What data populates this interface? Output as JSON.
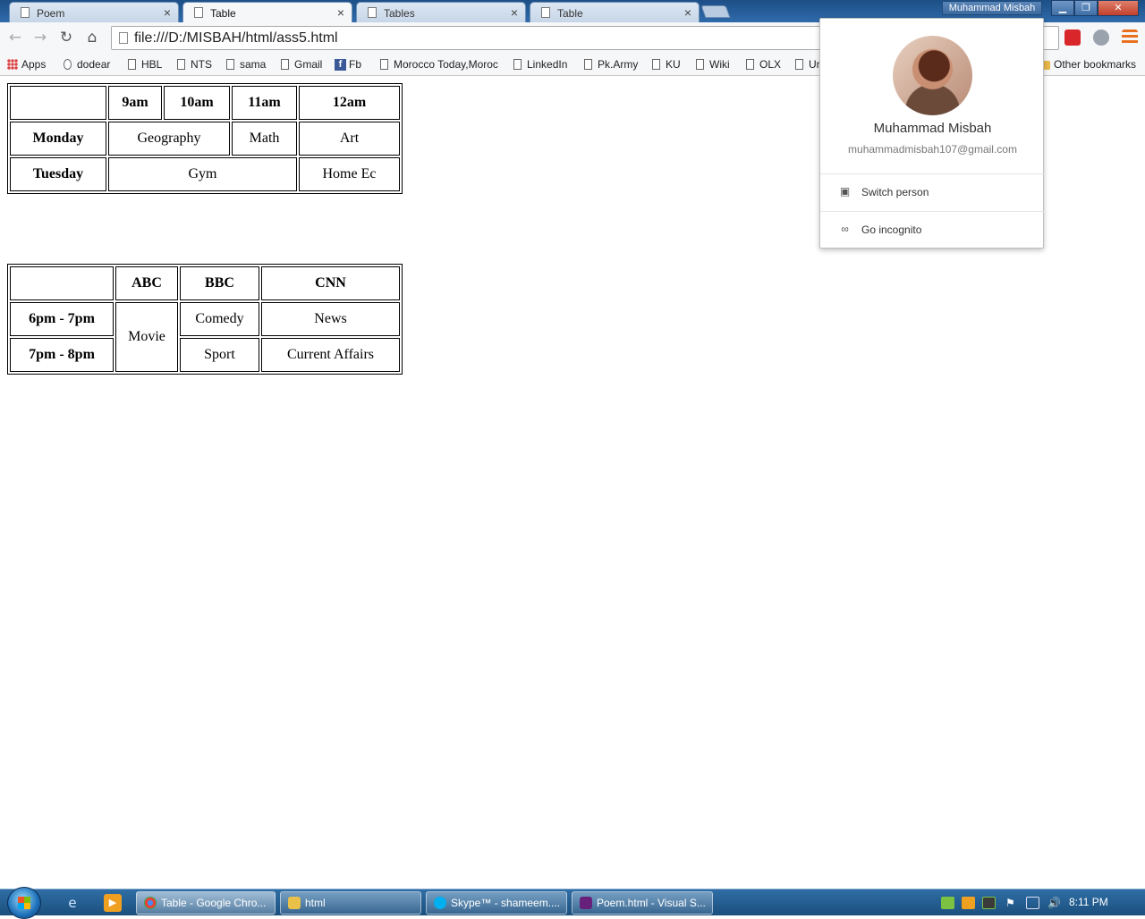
{
  "browser": {
    "tabs": [
      {
        "title": "Poem",
        "active": false
      },
      {
        "title": "Table",
        "active": true
      },
      {
        "title": "Tables",
        "active": false
      },
      {
        "title": "Table",
        "active": false
      }
    ],
    "profile_chip": "Muhammad Misbah",
    "url": "file:///D:/MISBAH/html/ass5.html",
    "bookmarks": [
      {
        "label": "Apps",
        "icon": "apps-grid-icon"
      },
      {
        "label": "dodear",
        "icon": "globe-icon"
      },
      {
        "label": "HBL",
        "icon": "page-icon"
      },
      {
        "label": "NTS",
        "icon": "page-icon"
      },
      {
        "label": "sama",
        "icon": "page-icon"
      },
      {
        "label": "Gmail",
        "icon": "page-icon"
      },
      {
        "label": "Fb",
        "icon": "facebook-icon"
      },
      {
        "label": "Morocco Today,Moroc",
        "icon": "page-icon"
      },
      {
        "label": "LinkedIn",
        "icon": "page-icon"
      },
      {
        "label": "Pk.Army",
        "icon": "page-icon"
      },
      {
        "label": "KU",
        "icon": "page-icon"
      },
      {
        "label": "Wiki",
        "icon": "page-icon"
      },
      {
        "label": "OLX",
        "icon": "page-icon"
      },
      {
        "label": "Ur",
        "icon": "page-icon"
      }
    ],
    "other_bookmarks": "Other bookmarks"
  },
  "schedule_table": {
    "headers": [
      "",
      "9am",
      "10am",
      "11am",
      "12am"
    ],
    "rows": [
      {
        "day": "Monday",
        "cells": [
          "Geography",
          "Math",
          "Art"
        ]
      },
      {
        "day": "Tuesday",
        "cells": [
          "Gym",
          "Home Ec"
        ]
      }
    ]
  },
  "tv_table": {
    "headers": [
      "",
      "ABC",
      "BBC",
      "CNN"
    ],
    "rows": [
      {
        "time": "6pm - 7pm",
        "abc": "Movie",
        "bbc": "Comedy",
        "cnn": "News"
      },
      {
        "time": "7pm - 8pm",
        "bbc": "Sport",
        "cnn": "Current Affairs"
      }
    ]
  },
  "profile_popup": {
    "name": "Muhammad Misbah",
    "email": "muhammadmisbah107@gmail.com",
    "switch_person": "Switch person",
    "go_incognito": "Go incognito"
  },
  "taskbar": {
    "items": [
      {
        "label": "Table - Google Chro...",
        "active": true
      },
      {
        "label": "html",
        "active": false
      },
      {
        "label": "Skype™ - shameem....",
        "active": false
      },
      {
        "label": "Poem.html - Visual S...",
        "active": false
      }
    ],
    "clock": "8:11 PM"
  },
  "colors": {
    "titlebar": "#2f6bab",
    "taskbar": "#1b4f7e",
    "popup_bg": "#ffffff"
  }
}
